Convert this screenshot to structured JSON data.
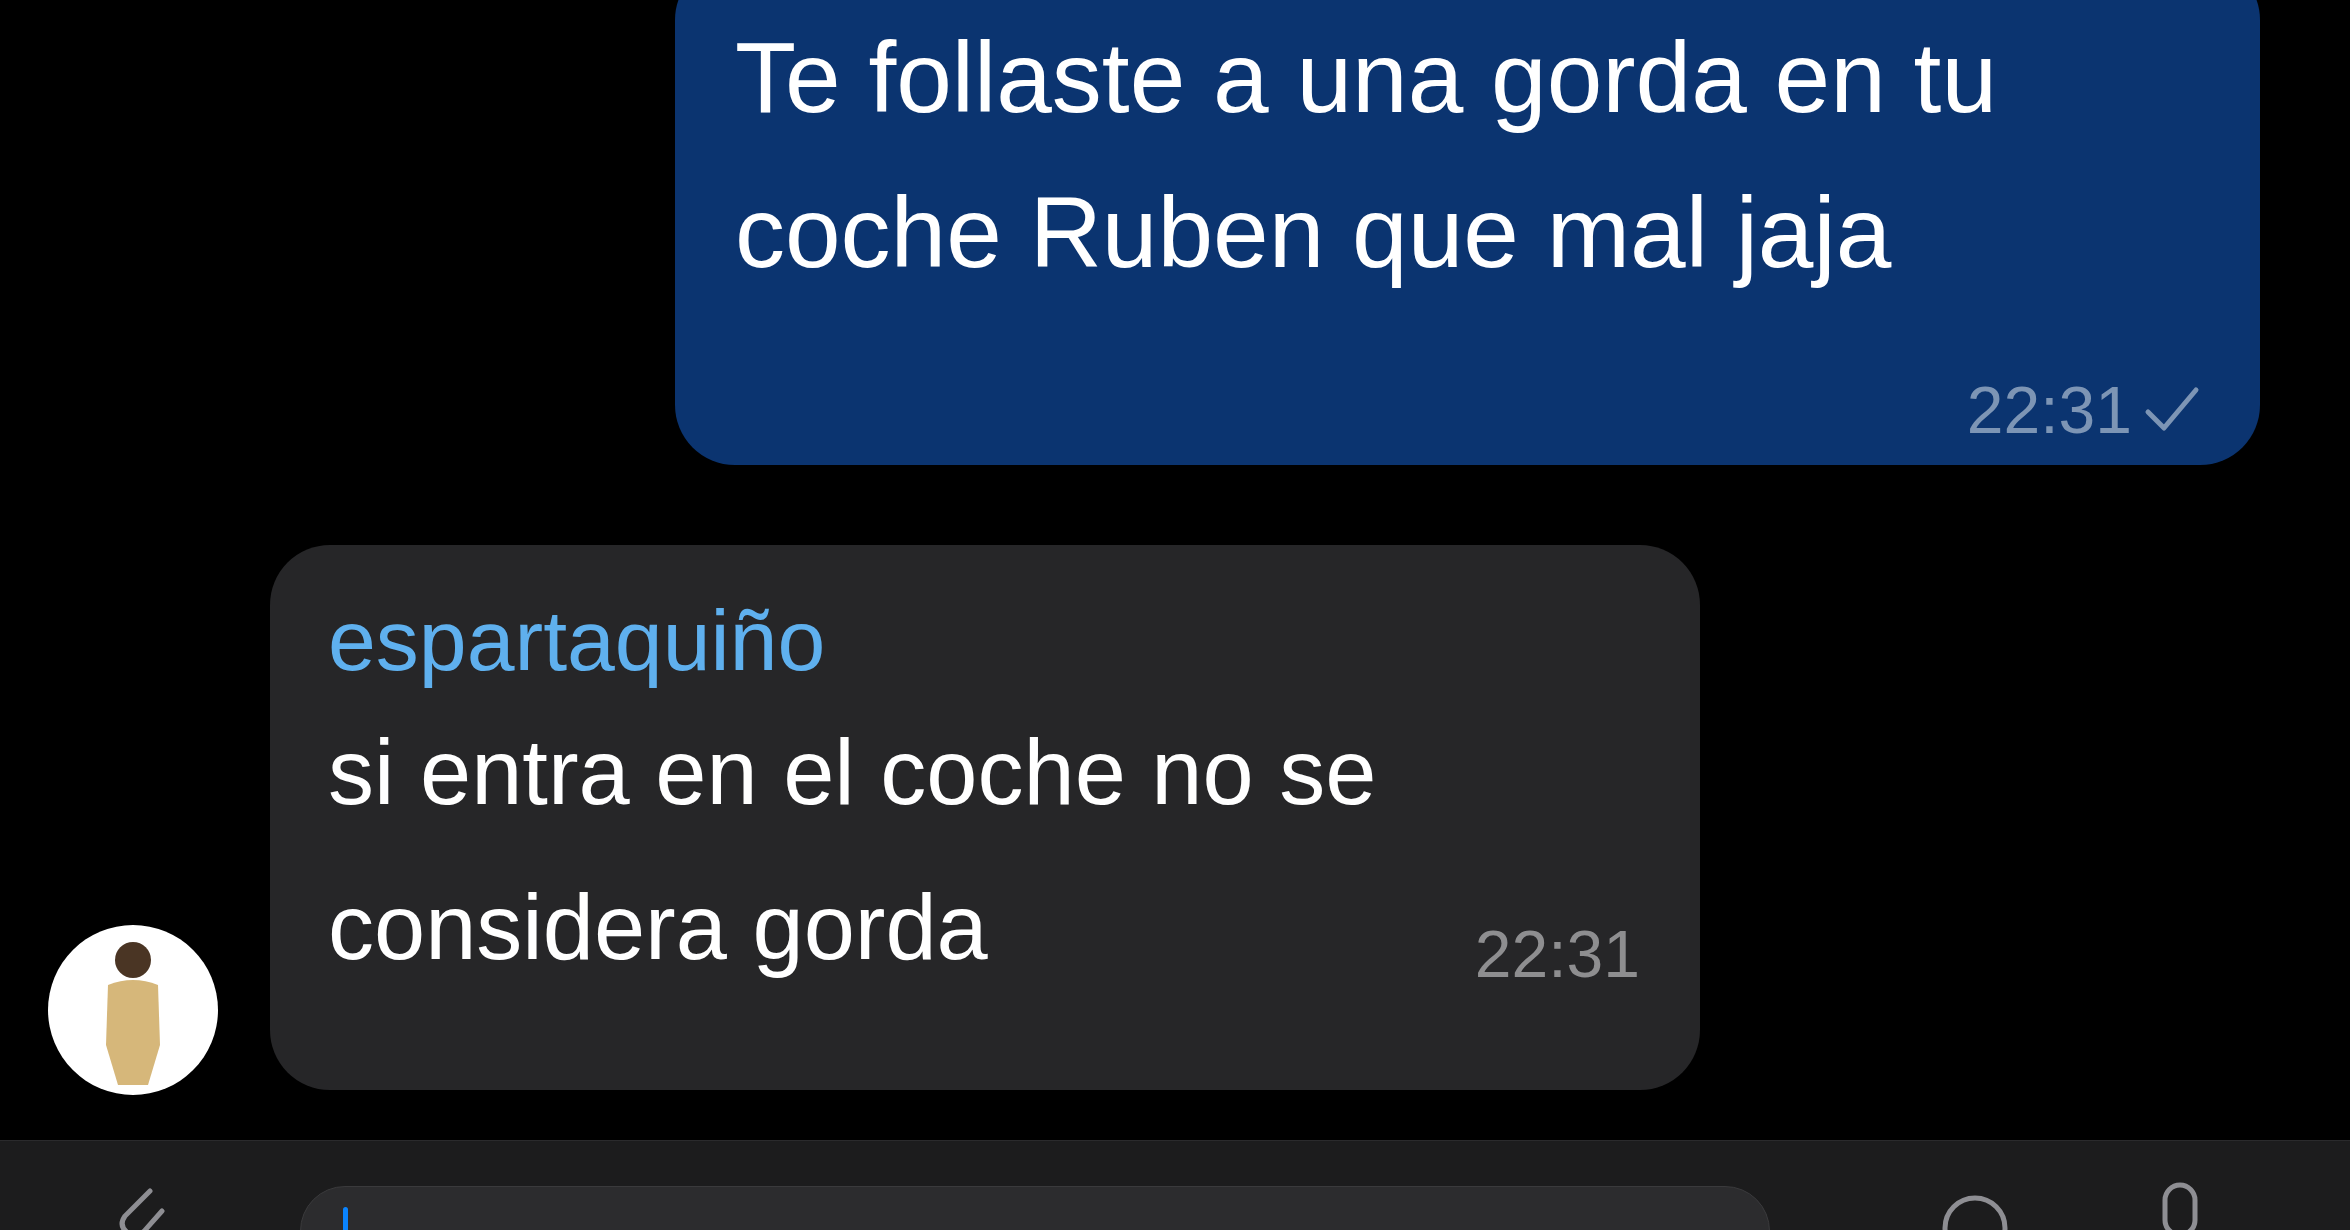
{
  "messages": [
    {
      "kind": "outgoing",
      "text": "Te follaste a una gorda en tu coche Ruben que mal jaja",
      "time": "22:31",
      "read": false
    },
    {
      "kind": "incoming",
      "sender": "espartaquiño",
      "text": "si entra en el coche no se considera gorda",
      "time": "22:31"
    }
  ]
}
